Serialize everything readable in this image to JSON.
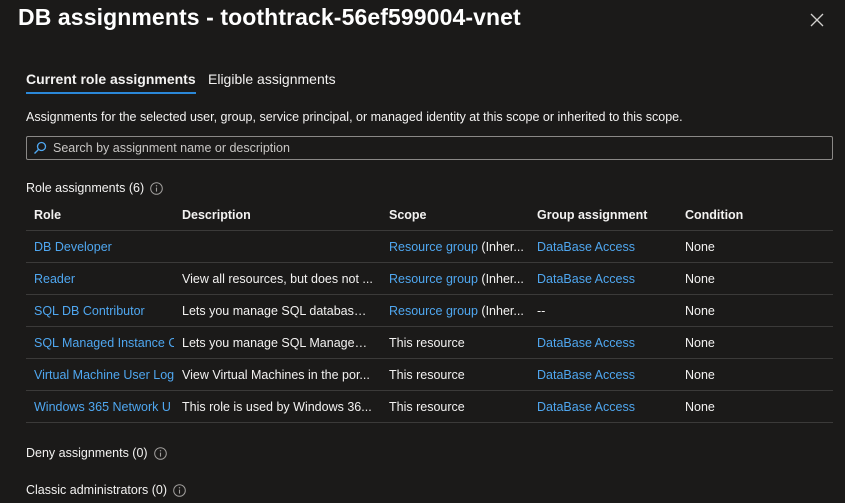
{
  "title": "DB assignments - toothtrack-56ef599004-vnet",
  "tabs": [
    {
      "label": "Current role assignments",
      "active": true
    },
    {
      "label": "Eligible assignments",
      "active": false
    }
  ],
  "description": "Assignments for the selected user, group, service principal, or managed identity at this scope or inherited to this scope.",
  "search": {
    "placeholder": "Search by assignment name or description",
    "value": ""
  },
  "role_assignments": {
    "heading": "Role assignments (6)",
    "columns": [
      "Role",
      "Description",
      "Scope",
      "Group assignment",
      "Condition"
    ],
    "rows": [
      {
        "role": "DB Developer",
        "description": "",
        "scope_link": "Resource group",
        "scope_suffix": " (Inher...",
        "group": "DataBase Access",
        "condition": "None"
      },
      {
        "role": "Reader",
        "description": "View all resources, but does not ...",
        "scope_link": "Resource group",
        "scope_suffix": " (Inher...",
        "group": "DataBase Access",
        "condition": "None"
      },
      {
        "role": "SQL DB Contributor",
        "description": "Lets you manage SQL databases,...",
        "scope_link": "Resource group",
        "scope_suffix": " (Inher...",
        "group": "--",
        "condition": "None"
      },
      {
        "role": "SQL Managed Instance C",
        "description": "Lets you manage SQL Managed I...",
        "scope_text": "This resource",
        "group": "DataBase Access",
        "condition": "None"
      },
      {
        "role": "Virtual Machine User Log",
        "description": "View Virtual Machines in the por...",
        "scope_text": "This resource",
        "group": "DataBase Access",
        "condition": "None"
      },
      {
        "role": "Windows 365 Network U",
        "description": "This role is used by Windows 36...",
        "scope_text": "This resource",
        "group": "DataBase Access",
        "condition": "None"
      }
    ]
  },
  "deny_assignments": {
    "heading": "Deny assignments (0)"
  },
  "classic_admins": {
    "heading": "Classic administrators (0)"
  },
  "colors": {
    "link": "#4fa7f0",
    "background": "#1b1a19",
    "tab_underline": "#2b88d8"
  },
  "icons": {
    "close": "close-icon",
    "search": "search-icon",
    "info": "info-icon"
  }
}
